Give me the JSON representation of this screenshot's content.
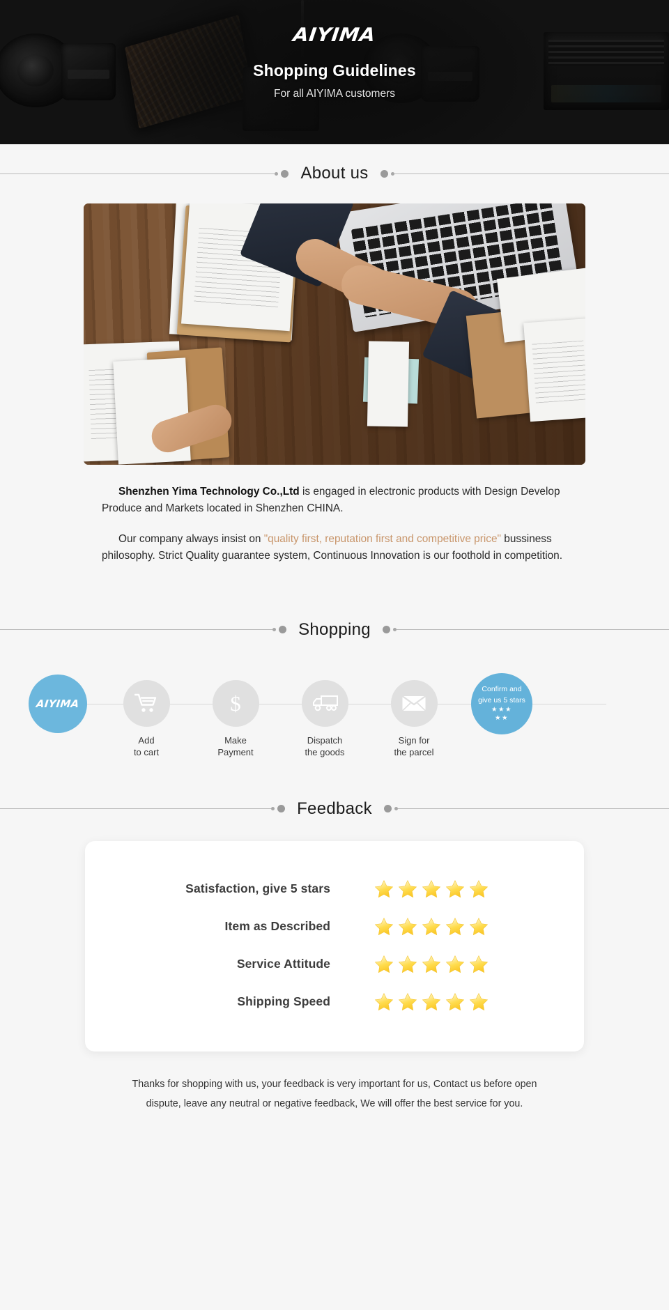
{
  "hero": {
    "logo": "AIYIMA",
    "title": "Shopping Guidelines",
    "subtitle": "For all AIYIMA customers",
    "bg_color": "#141414"
  },
  "sections": {
    "about": {
      "title": "About us"
    },
    "shopping": {
      "title": "Shopping"
    },
    "feedback": {
      "title": "Feedback"
    }
  },
  "about": {
    "image_alt": "business handshake over wooden desk with documents and laptop",
    "paragraph1_strong": "Shenzhen Yima Technology Co.,Ltd",
    "paragraph1_rest": " is engaged in electronic products with Design Develop Produce and Markets located in Shenzhen CHINA.",
    "paragraph2_before": "Our company always insist on ",
    "paragraph2_quote": "\"quality first, reputation first and competitive price\"",
    "paragraph2_after": " bussiness philosophy. Strict Quality guarantee system, Continuous Innovation is our foothold in competition.",
    "quote_color": "#c8956a"
  },
  "shopping": {
    "brand_circle_label": "AIYIMA",
    "brand_circle_color": "#6cb7dd",
    "steps": [
      {
        "icon": "cart-icon",
        "label": "Add\nto cart"
      },
      {
        "icon": "dollar-icon",
        "label": "Make\nPayment"
      },
      {
        "icon": "truck-icon",
        "label": "Dispatch\nthe goods"
      },
      {
        "icon": "envelope-icon",
        "label": "Sign for\nthe parcel"
      }
    ],
    "final_circle": {
      "line1": "Confirm and",
      "line2": "give us 5 stars",
      "stars_row1": "★★★",
      "stars_row2": "★★",
      "color": "#64b2da"
    }
  },
  "feedback": {
    "rows": [
      {
        "label": "Satisfaction, give 5 stars",
        "stars": 5
      },
      {
        "label": "Item as Described",
        "stars": 5
      },
      {
        "label": "Service Attitude",
        "stars": 5
      },
      {
        "label": "Shipping Speed",
        "stars": 5
      }
    ],
    "star_color": "#ffd84d"
  },
  "footer": {
    "line1": "Thanks for shopping with us, your feedback is very important for us, Contact us before open",
    "line2": "dispute, leave any neutral or negative feedback, We will offer the best service for you."
  }
}
